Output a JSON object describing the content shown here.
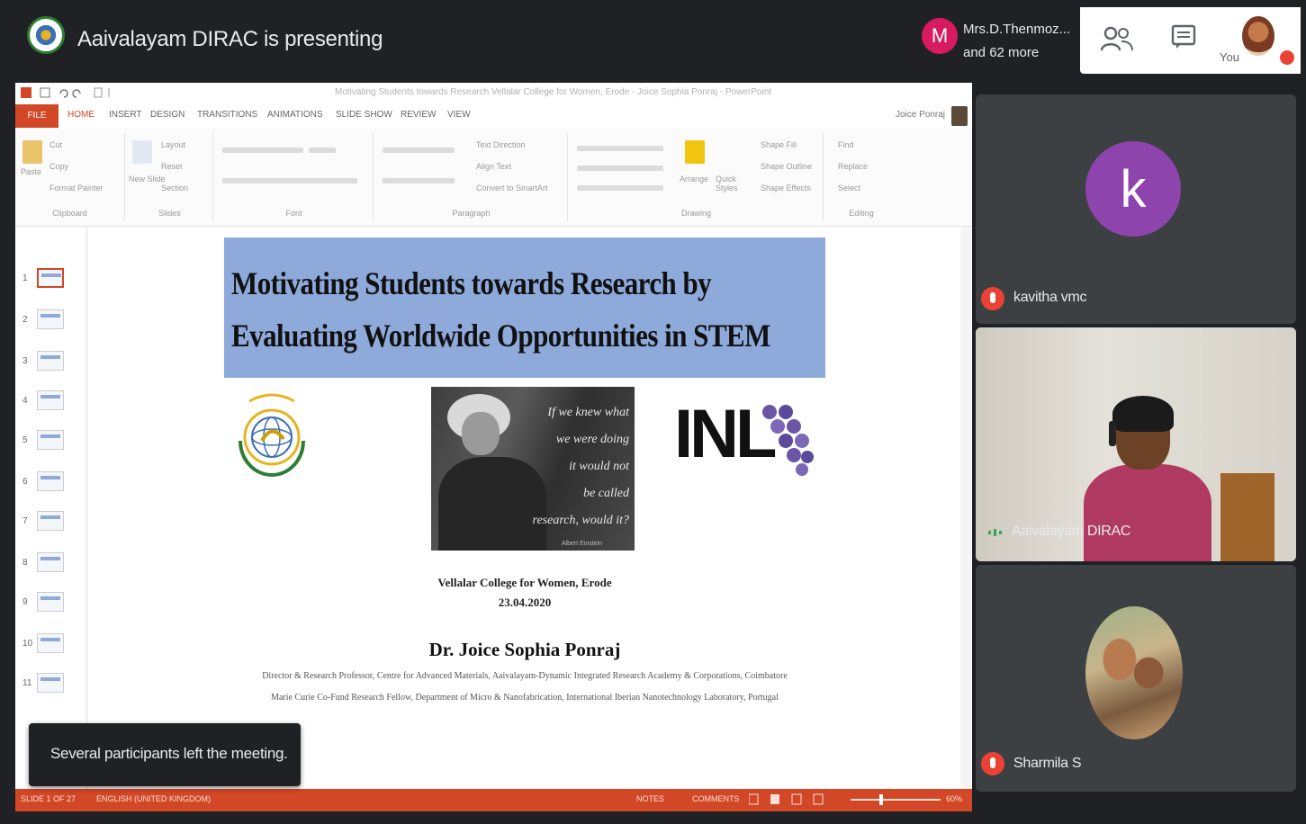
{
  "meeting": {
    "presenting_label": "Aaivalayam DIRAC is presenting",
    "participants_avatar_letter": "M",
    "participants_line1": "Mrs.D.Thenmoz...",
    "participants_line2": "and 62 more",
    "you_label": "You"
  },
  "ppt": {
    "doc_title": "Motivating Students towards Research Vellalar College for Women, Erode - Joice Sophia Ponraj - PowerPoint",
    "tabs": [
      "FILE",
      "HOME",
      "INSERT",
      "DESIGN",
      "TRANSITIONS",
      "ANIMATIONS",
      "SLIDE SHOW",
      "REVIEW",
      "VIEW"
    ],
    "user_name": "Joice Ponraj",
    "ribbon_groups": {
      "clipboard": "Clipboard",
      "slides": "Slides",
      "font": "Font",
      "paragraph": "Paragraph",
      "drawing": "Drawing",
      "editing": "Editing"
    },
    "ribbon_items": {
      "cut": "Cut",
      "copy": "Copy",
      "format_painter": "Format Painter",
      "paste": "Paste",
      "new_slide": "New Slide",
      "layout": "Layout",
      "reset": "Reset",
      "section": "Section",
      "text_direction": "Text Direction",
      "align_text": "Align Text",
      "convert_smartart": "Convert to SmartArt",
      "arrange": "Arrange",
      "quick_styles": "Quick Styles",
      "shape_fill": "Shape Fill",
      "shape_outline": "Shape Outline",
      "shape_effects": "Shape Effects",
      "find": "Find",
      "replace": "Replace",
      "select": "Select"
    },
    "thumbnails": [
      "1",
      "2",
      "3",
      "4",
      "5",
      "6",
      "7",
      "8",
      "9",
      "10",
      "11"
    ],
    "status": {
      "slide_count": "SLIDE 1 OF 27",
      "language": "ENGLISH (UNITED KINGDOM)",
      "notes": "NOTES",
      "comments": "COMMENTS",
      "zoom": "60%"
    }
  },
  "slide": {
    "title_line1": "Motivating Students towards Research by",
    "title_line2": "Evaluating Worldwide Opportunities in STEM",
    "quote_line1": "If we knew what",
    "quote_line2": "we were doing",
    "quote_line3": "it would not",
    "quote_line4": "be called",
    "quote_line5": "research, would it?",
    "quote_attribution": "Albert Einstein",
    "inl_logo_text": "INL",
    "college": "Vellalar College for Women, Erode",
    "date": "23.04.2020",
    "speaker": "Dr. Joice Sophia Ponraj",
    "affiliation1": "Director & Research Professor, Centre for Advanced Materials, Aaivalayam-Dynamic Integrated Research Academy & Corporations, Coimbatore",
    "affiliation2": "Marie Curie Co-Fund Research Fellow, Department of Micro & Nanofabrication, International Iberian Nanotechnology Laboratory, Portugal"
  },
  "toast": {
    "message": "Several participants left the meeting."
  },
  "participants": [
    {
      "avatar_letter": "k",
      "name": "kavitha vmc",
      "avatar_color": "#8e44ad"
    },
    {
      "name": "Aaivalayam DIRAC"
    },
    {
      "name": "Sharmila S"
    }
  ],
  "colors": {
    "ppt_accent": "#d24726",
    "slide_header": "#8eaadb",
    "meet_bg": "#202124",
    "mic_off": "#ea4335"
  }
}
